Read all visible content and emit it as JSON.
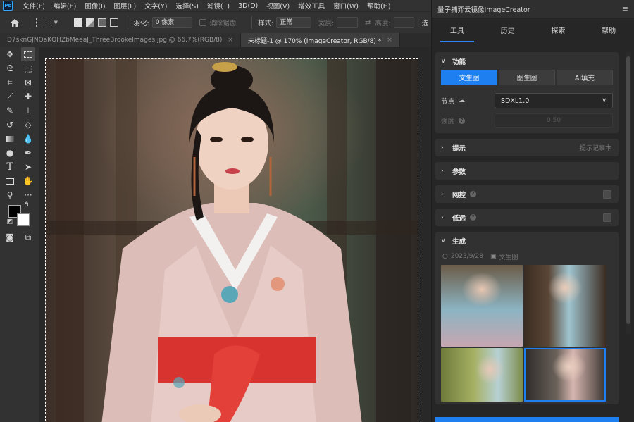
{
  "menubar": {
    "logo": "Ps",
    "items": [
      "文件(F)",
      "编辑(E)",
      "图像(I)",
      "图层(L)",
      "文字(Y)",
      "选择(S)",
      "滤镜(T)",
      "3D(D)",
      "视图(V)",
      "增效工具",
      "窗口(W)",
      "帮助(H)"
    ]
  },
  "options": {
    "feather_label": "羽化:",
    "feather_value": "0 像素",
    "antialias_label": "消除锯齿",
    "style_label": "样式:",
    "style_value": "正常",
    "width_label": "宽度:",
    "height_label": "高度:",
    "select_label": "选"
  },
  "doc_tabs": [
    {
      "label": "D7sknGJNQaKQHZbMeeaJ_ThreeBrookeImages.jpg @ 66.7%(RGB/8)",
      "close": "×"
    },
    {
      "label": "未标题-1 @ 170% (ImageCreator, RGB/8) *",
      "close": "×"
    }
  ],
  "panel": {
    "title": "量子捕弈云镜像ImageCreator",
    "menu_icon": "≡",
    "tabs": [
      "工具",
      "历史",
      "探索",
      "帮助"
    ],
    "active_tab": 0,
    "function_section": {
      "title": "功能",
      "modes": [
        "文生图",
        "图生图",
        "Ai填充"
      ],
      "active_mode": 0,
      "node_label": "节点",
      "node_value": "SDXL1.0",
      "strength_label": "强度",
      "strength_value": "0.50"
    },
    "prompt_section": {
      "title": "提示",
      "right_text": "提示记事本"
    },
    "params_section": {
      "title": "参数"
    },
    "control_section": {
      "title": "网控"
    },
    "lowres_section": {
      "title": "低远"
    },
    "generate_section": {
      "title": "生成",
      "date": "2023/9/28",
      "mode_tag": "文生图"
    }
  },
  "colors": {
    "accent": "#1e7ff0",
    "panel_bg": "#262626",
    "ui_bg": "#323232"
  }
}
